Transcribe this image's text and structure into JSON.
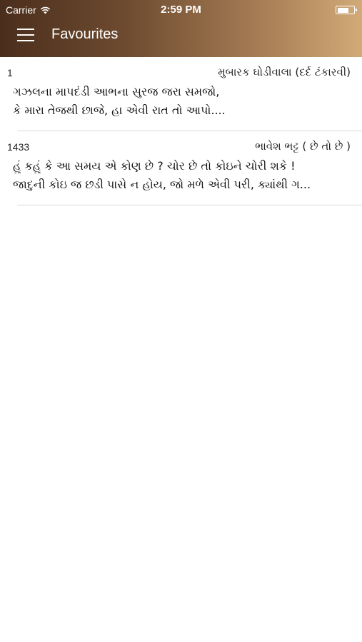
{
  "status_bar": {
    "carrier": "Carrier",
    "time": "2:59 PM",
    "battery_level": 0.75
  },
  "header": {
    "title": "Favourites",
    "menu_icon": "hamburger-menu-icon",
    "gradient_colors": [
      "#4a2e1c",
      "#d2aa78"
    ]
  },
  "favourites": [
    {
      "number": "1",
      "author": "મુબારક ઘોડીવાલા (દર્દ ટંકારવી)",
      "line1": "ગઝલના માપદંડી આભના સુરજ જરા સમજો,",
      "line2": "કે મારા તેજથી છાજે, હા એવી રાત તો આપો...."
    },
    {
      "number": "1433",
      "author": "ભાવેશ ભટ્ટ ( છે તો છે )",
      "line1": "હું કહું કે આ સમય એ કોણ છે ? ચોર છે તો કોઇને ચોરી શકે !",
      "line2": "જાદુની કોઇ જ છડી પાસે ન હોય, જો મળે એવી પરી, ક્યાંથી ગ..."
    }
  ]
}
